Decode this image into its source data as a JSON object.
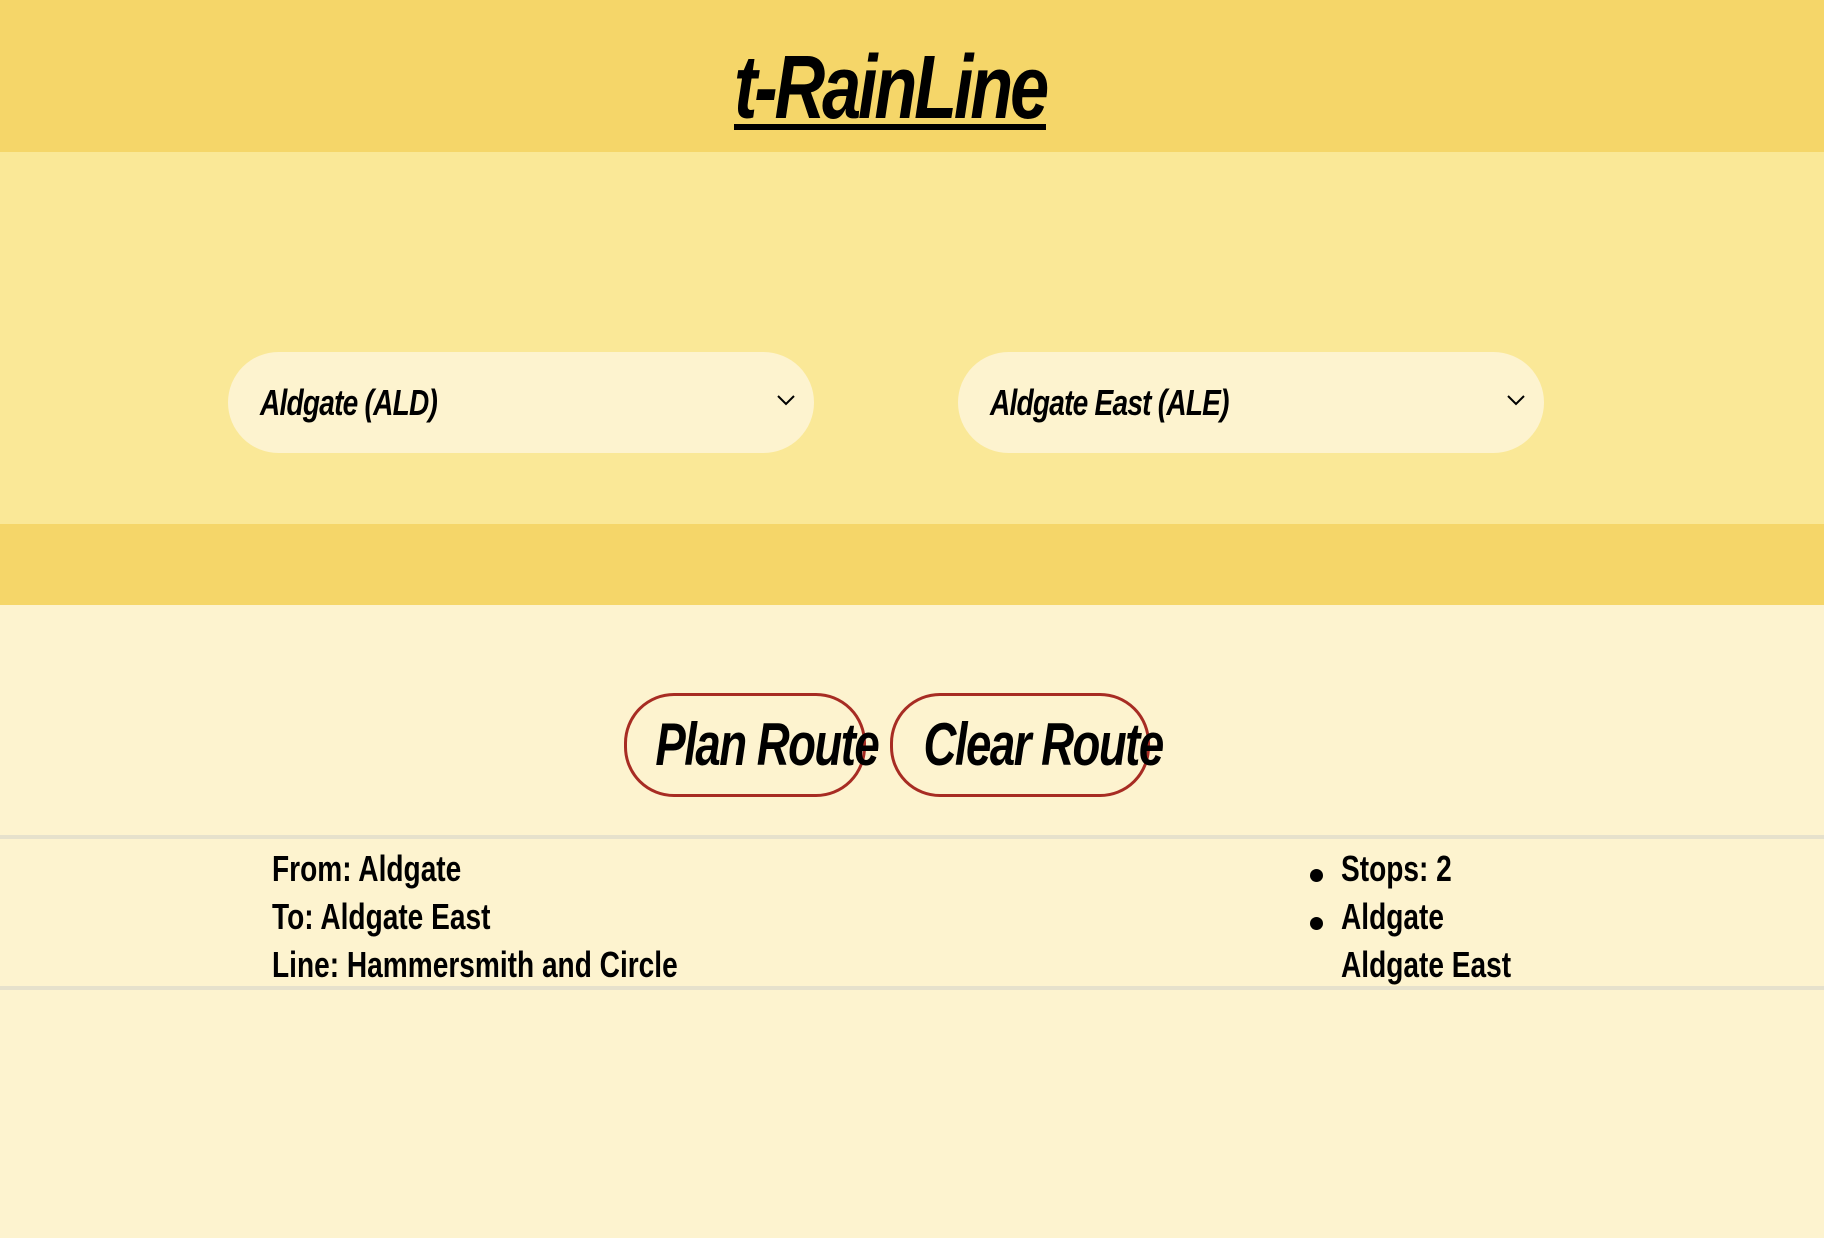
{
  "header": {
    "title": "t-RainLine"
  },
  "route_form": {
    "from_select": {
      "selected": "Aldgate (ALD)",
      "icon": "chevron-down-icon"
    },
    "to_select": {
      "selected": "Aldgate East (ALE)",
      "icon": "chevron-down-icon"
    }
  },
  "actions": {
    "plan_label": "Plan Route",
    "clear_label": "Clear Route"
  },
  "result": {
    "from": "From: Aldgate",
    "to": "To: Aldgate East",
    "line": "Line: Hammersmith and Circle",
    "stops": "Stops: 2",
    "stop_list": [
      "Aldgate",
      "Aldgate East"
    ]
  },
  "colors": {
    "header_bg": "#f5d669",
    "select_band_bg": "#fae897",
    "page_bg": "#fdf3cf",
    "button_border": "#a72c23"
  }
}
